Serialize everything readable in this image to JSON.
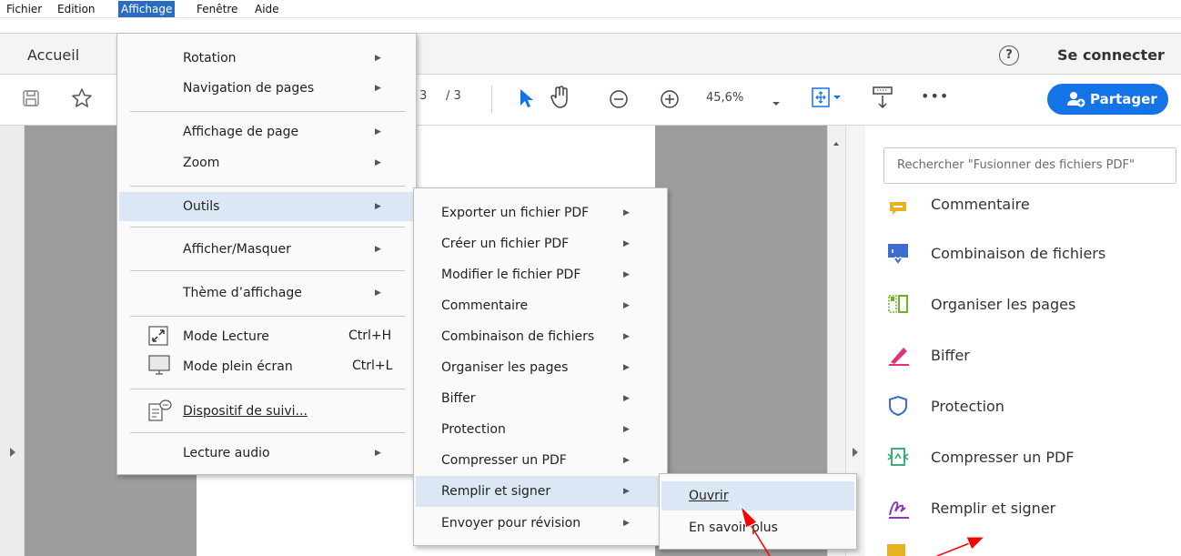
{
  "menubar": {
    "items": [
      {
        "label": "Fichier"
      },
      {
        "label": "Edition"
      },
      {
        "label": "Affichage"
      },
      {
        "label": "Fenêtre"
      },
      {
        "label": "Aide"
      }
    ]
  },
  "tabs": {
    "home": "Accueil",
    "help_symbol": "?",
    "signin": "Se connecter"
  },
  "toolbar": {
    "page_current": "3",
    "page_total": "/ 3",
    "zoom": "45,6%",
    "more": "•••",
    "share_label": "Partager"
  },
  "view_menu": {
    "items": [
      {
        "label": "Rotation",
        "submenu": true
      },
      {
        "label": "Navigation de pages",
        "submenu": true
      },
      {
        "label": "Affichage de page",
        "submenu": true
      },
      {
        "label": "Zoom",
        "submenu": true
      },
      {
        "label": "Outils",
        "submenu": true,
        "highlighted": true
      },
      {
        "label": "Afficher/Masquer",
        "submenu": true
      },
      {
        "label": "Thème d’affichage",
        "submenu": true
      },
      {
        "label": "Mode Lecture",
        "shortcut": "Ctrl+H"
      },
      {
        "label": "Mode plein écran",
        "shortcut": "Ctrl+L"
      },
      {
        "label": "Dispositif de suivi..."
      },
      {
        "label": "Lecture audio",
        "submenu": true
      }
    ]
  },
  "tools_menu": {
    "items": [
      {
        "label": "Exporter un fichier PDF"
      },
      {
        "label": "Créer un fichier PDF"
      },
      {
        "label": "Modifier le fichier PDF"
      },
      {
        "label": "Commentaire"
      },
      {
        "label": "Combinaison de fichiers"
      },
      {
        "label": "Organiser les pages"
      },
      {
        "label": "Biffer"
      },
      {
        "label": "Protection"
      },
      {
        "label": "Compresser un PDF"
      },
      {
        "label": "Remplir et signer",
        "highlighted": true
      },
      {
        "label": "Envoyer pour révision"
      }
    ]
  },
  "sign_menu": {
    "items": [
      {
        "label": "Ouvrir",
        "highlighted": true
      },
      {
        "label": "En savoir plus"
      }
    ]
  },
  "right_panel": {
    "search_placeholder": "Rechercher \"Fusionner des fichiers PDF\"",
    "tools": [
      {
        "label": "Commentaire",
        "icon": "comment-icon",
        "color": "#e8b21e"
      },
      {
        "label": "Combinaison de fichiers",
        "icon": "combine-files-icon",
        "color": "#3c6bd1"
      },
      {
        "label": "Organiser les pages",
        "icon": "organize-pages-icon",
        "color": "#6bb324"
      },
      {
        "label": "Biffer",
        "icon": "redact-icon",
        "color": "#e0327e"
      },
      {
        "label": "Protection",
        "icon": "protect-icon",
        "color": "#3c6bd1"
      },
      {
        "label": "Compresser un PDF",
        "icon": "compress-icon",
        "color": "#2aa76a"
      },
      {
        "label": "Remplir et signer",
        "icon": "fill-sign-icon",
        "color": "#8a3ab9"
      }
    ]
  },
  "colors": {
    "accent": "#1473e6",
    "menu_highlight": "#dbe7f4",
    "annotation_arrow": "#ff0000"
  }
}
